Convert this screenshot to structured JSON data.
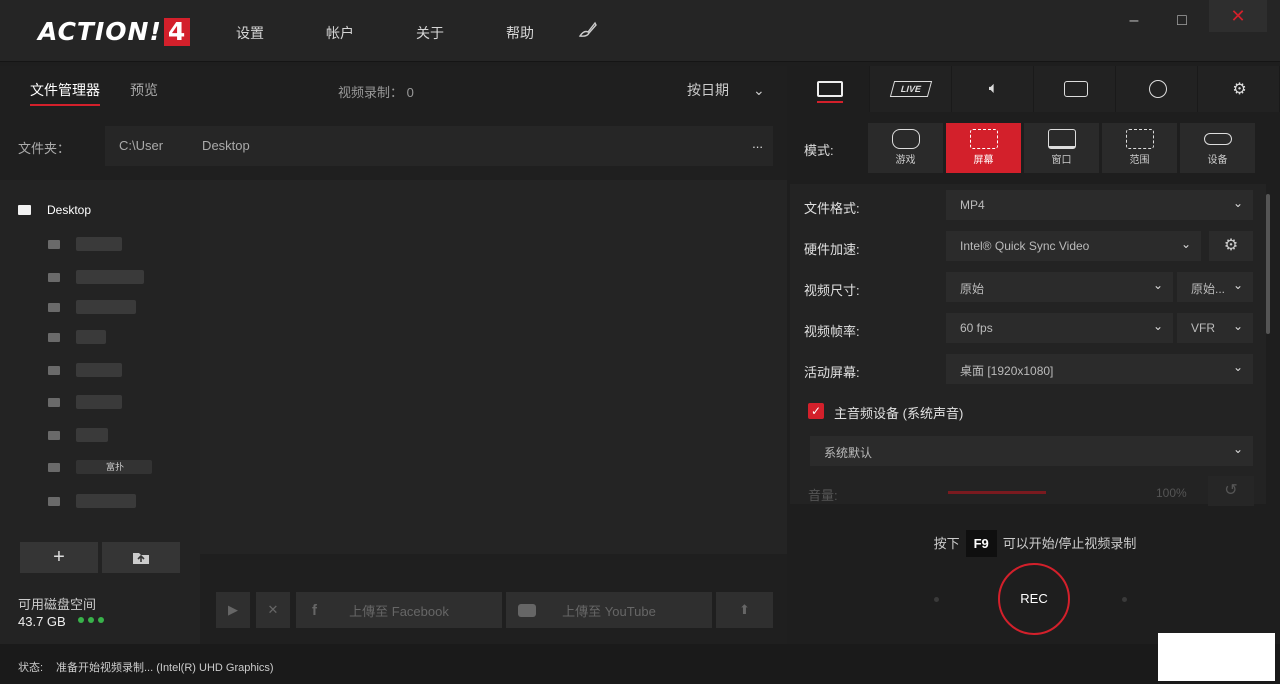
{
  "app": {
    "logo_main": "ACTION!",
    "logo_num": "4"
  },
  "menu": [
    "设置",
    "帐户",
    "关于",
    "帮助"
  ],
  "window": {
    "min": "‒",
    "max": "□",
    "close": "✕"
  },
  "left": {
    "tabs": [
      "文件管理器",
      "预览"
    ],
    "recordings": "视频录制： 0",
    "sort": "按日期",
    "folder_label": "文件夹：",
    "folder_path": "C:\\User      Desktop",
    "folder_more": "...",
    "tree_root": "Desktop",
    "tree_item_text": "富扑",
    "disk_label": "可用磁盘空间",
    "disk_value": "43.7 GB",
    "upload_facebook": "上傳至 Facebook",
    "upload_youtube": "上傳至 YouTube"
  },
  "right": {
    "mode_label": "模式:",
    "modes": [
      "游戏",
      "屏幕",
      "窗口",
      "范围",
      "设备"
    ],
    "rows": {
      "format_label": "文件格式:",
      "format_value": "MP4",
      "hw_label": "硬件加速:",
      "hw_value": "Intel® Quick Sync Video",
      "size_label": "视频尺寸:",
      "size_value": "原始",
      "size_value2": "原始...",
      "fps_label": "视频帧率:",
      "fps_value": "60 fps",
      "fps_mode": "VFR",
      "screen_label": "活动屏幕:",
      "screen_value": "桌面 [1920x1080]"
    },
    "audio_label": "主音频设备 (系统声音)",
    "audio_device": "系统默认",
    "volume_label": "音量:",
    "volume_value": "100%",
    "hint_pre": "按下",
    "hint_key": "F9",
    "hint_post": "可以开始/停止视频录制",
    "rec": "REC",
    "live": "LIVE"
  },
  "status": {
    "label": "状态:",
    "text": "准备开始视频录制... (Intel(R) UHD Graphics)"
  },
  "colors": {
    "accent": "#d3202b",
    "disk_ok": "#38b24a"
  }
}
